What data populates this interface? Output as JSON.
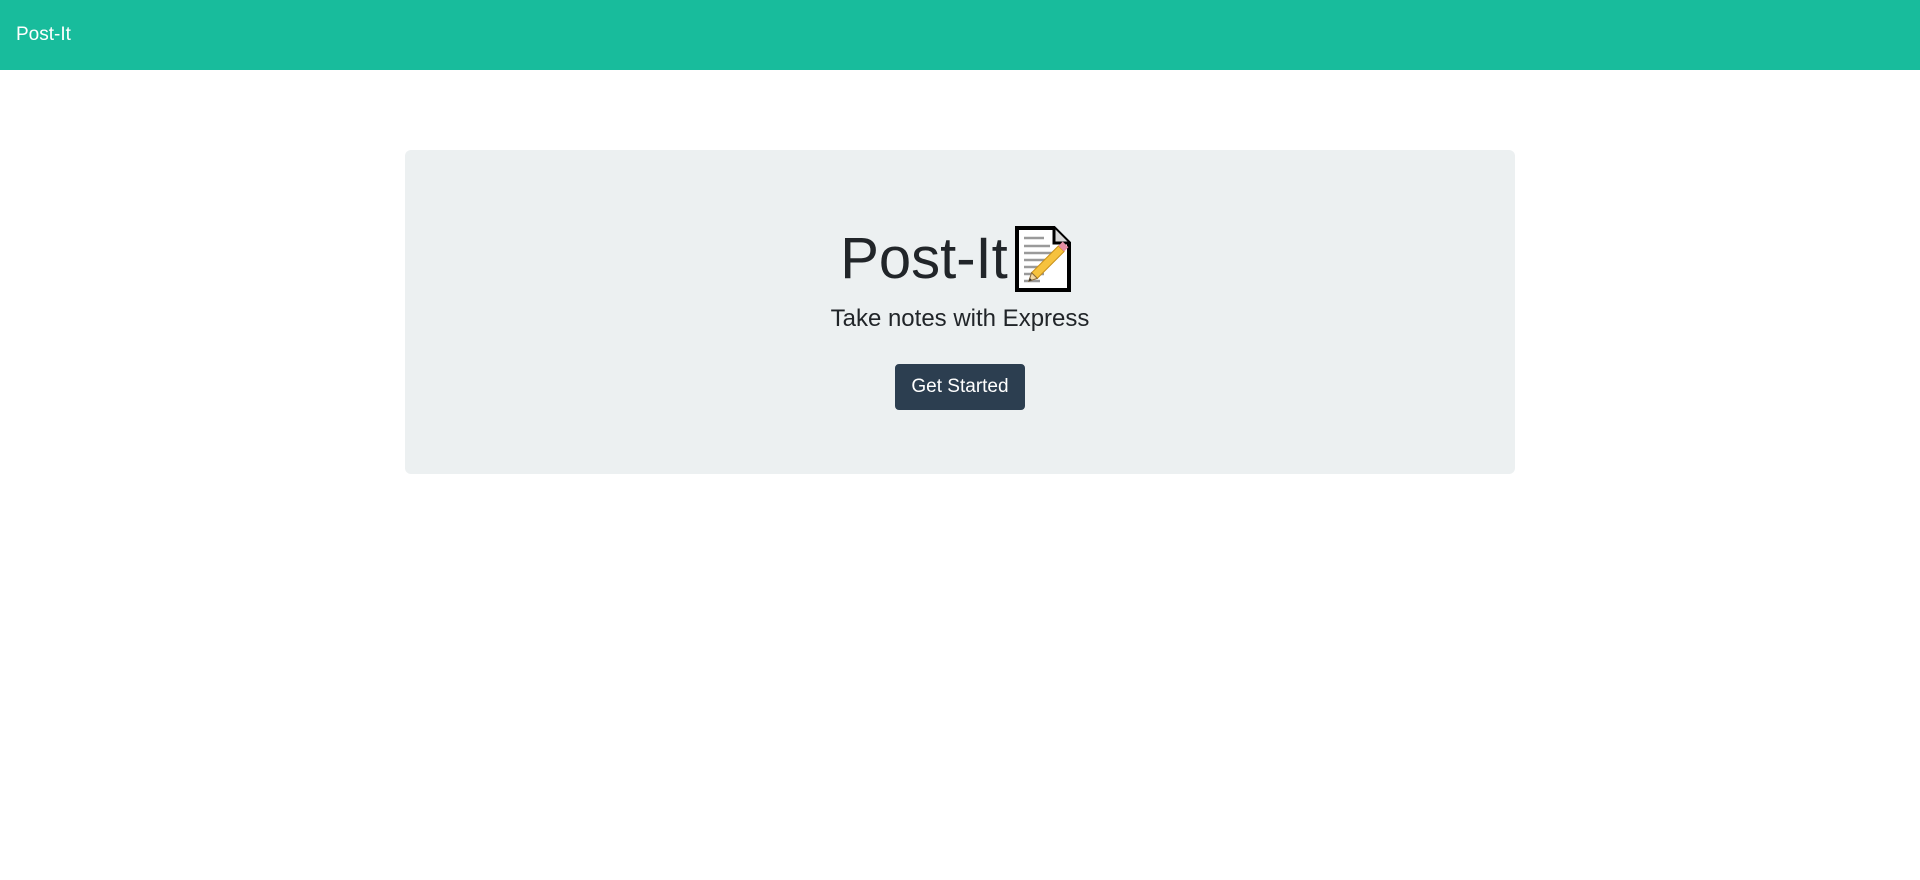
{
  "navbar": {
    "brand": "Post-It",
    "color": "#18bc9c"
  },
  "hero": {
    "title": "Post-It",
    "title_icon": "memo-icon",
    "subtitle": "Take notes with Express",
    "button_label": "Get Started",
    "background": "#ecf0f1",
    "button_color": "#2c3e50"
  }
}
